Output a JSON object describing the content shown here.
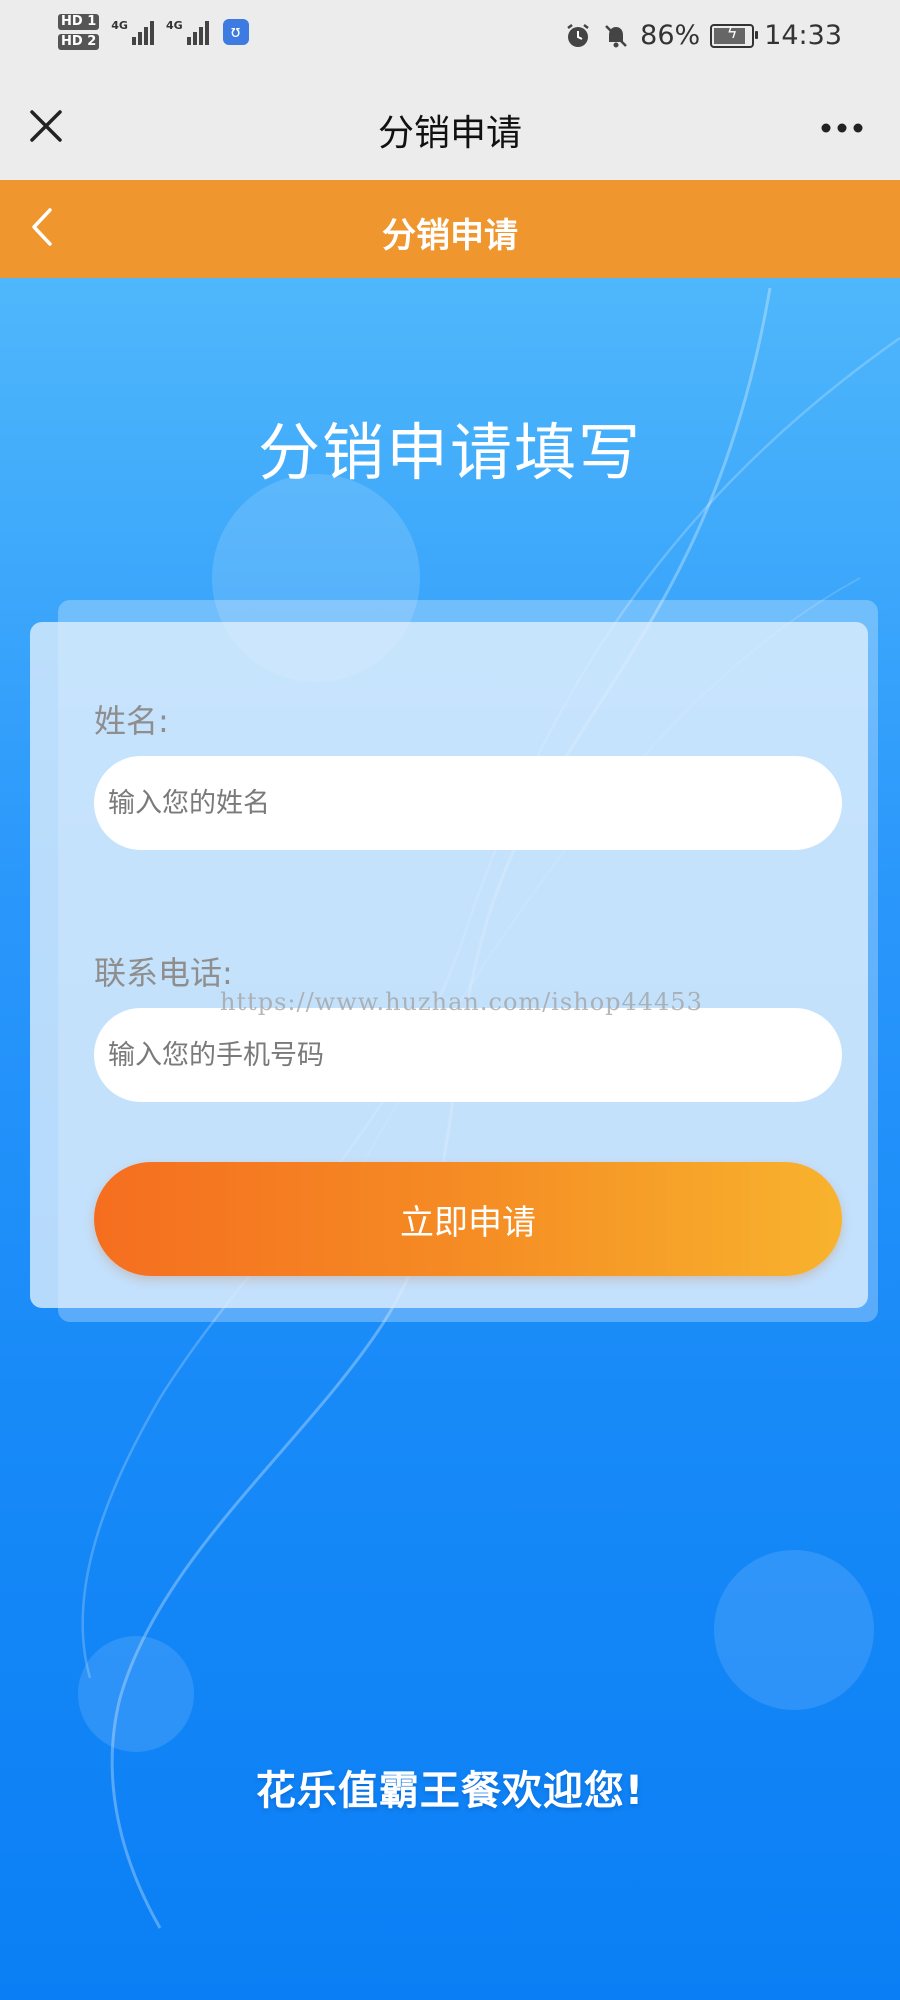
{
  "status_bar": {
    "hd1": "HD 1",
    "hd2": "HD 2",
    "network1": "4G",
    "network2": "4G",
    "battery_percent": "86%",
    "battery_level": 0.86,
    "time": "14:33",
    "icons": [
      "alarm-icon",
      "mute-icon",
      "battery-icon"
    ]
  },
  "title_bar": {
    "title": "分销申请"
  },
  "header": {
    "title": "分销申请"
  },
  "main": {
    "title": "分销申请填写",
    "form": {
      "name_label": "姓名:",
      "name_placeholder": "输入您的姓名",
      "name_value": "",
      "phone_label": "联系电话:",
      "phone_placeholder": "输入您的手机号码",
      "phone_value": "",
      "submit_label": "立即申请"
    },
    "watermark": "https://www.huzhan.com/ishop44453",
    "welcome": "花乐值霸王餐欢迎您!"
  },
  "colors": {
    "orange_header": "#f0962f",
    "button_start": "#f56e1f",
    "button_end": "#f8b32d",
    "background_top": "#4fb7fb",
    "background_bottom": "#0a7ff5"
  }
}
